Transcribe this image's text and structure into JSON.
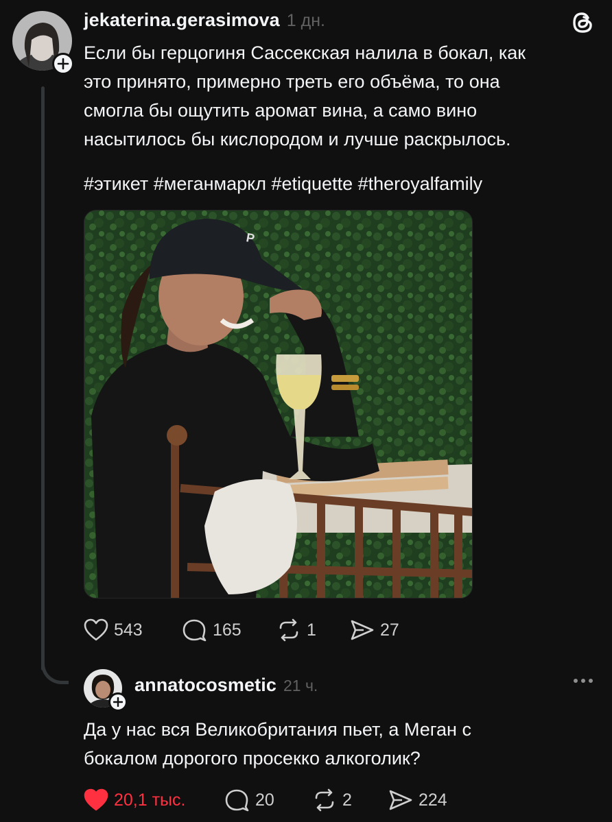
{
  "post": {
    "username": "jekaterina.gerasimova",
    "timestamp": "1 дн.",
    "text_lines": [
      "Если бы герцогиня Сассекская налила в бокал, как",
      "это принято, примерно треть его объёма, то она",
      "смогла бы ощутить аромат вина, а само вино",
      "насытилось бы кислородом и лучше раскрылось."
    ],
    "hashtags": "#этикет #меганмаркл #etiquette #theroyalfamily",
    "actions": {
      "likes": "543",
      "comments": "165",
      "reposts": "1",
      "shares": "27"
    }
  },
  "reply": {
    "username": "annatocosmetic",
    "timestamp": "21 ч.",
    "text_lines": [
      "Да у нас вся Великобритания пьет, а Меган с",
      "бокалом дорогого просекко алкоголик?"
    ],
    "actions": {
      "likes": "20,1 тыс.",
      "comments": "20",
      "reposts": "2",
      "shares": "224"
    },
    "liked": true
  },
  "icons": {
    "app_logo": "threads-logo-icon",
    "like": "heart-icon",
    "comment": "speech-bubble-icon",
    "repost": "repost-icon",
    "share": "send-icon",
    "follow": "plus-icon",
    "more": "more-dots-icon"
  },
  "colors": {
    "background": "#101010",
    "text": "#f3f5f7",
    "muted": "#616161",
    "liked_red": "#ff3040"
  }
}
